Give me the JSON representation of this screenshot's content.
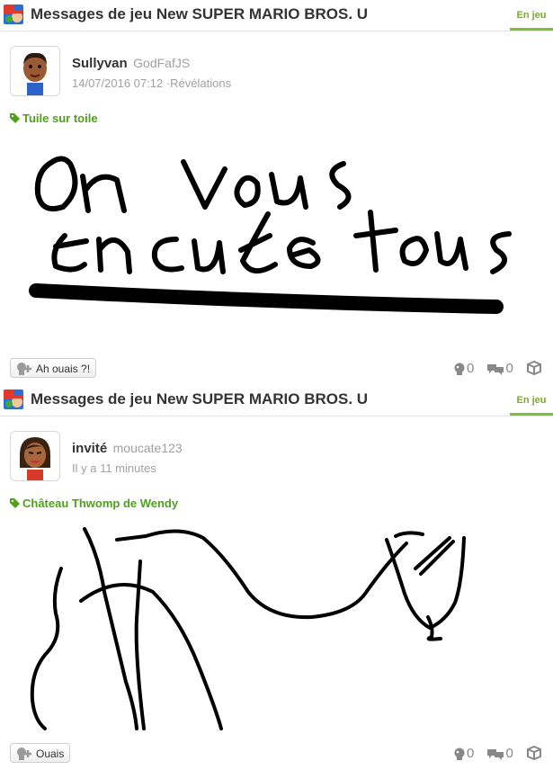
{
  "posts": [
    {
      "community": {
        "title": "Messages de jeu New SUPER MARIO BROS. U",
        "tab_label": "En jeu"
      },
      "author": {
        "name": "Sullyvan",
        "id": "GodFafJS"
      },
      "meta": {
        "date": "14/07/2016 07:12",
        "separator": " ·",
        "topic": "Révélations"
      },
      "tag": "Tuile sur toile",
      "yeah": {
        "label": "Ah ouais ?!"
      },
      "counts": {
        "yeahs": "0",
        "comments": "0"
      }
    },
    {
      "community": {
        "title": "Messages de jeu New SUPER MARIO BROS. U",
        "tab_label": "En jeu"
      },
      "author": {
        "name": "invité",
        "id": "moucate123"
      },
      "meta": {
        "date": "Il y a 11 minutes"
      },
      "tag": "Château Thwomp de Wendy",
      "yeah": {
        "label": "Ouais"
      },
      "counts": {
        "yeahs": "0",
        "comments": "0"
      }
    }
  ],
  "colors": {
    "tag_green": "#4fa11c",
    "tab_green": "#7ec233",
    "text_grey": "#a0a0a0"
  },
  "icons": {
    "community": "mario-game-icon",
    "tag": "tag-icon",
    "yeah": "empathy-icon",
    "yeah_count": "yeah-count-icon",
    "comment_count": "comment-count-icon",
    "spoiler": "cube-icon"
  }
}
